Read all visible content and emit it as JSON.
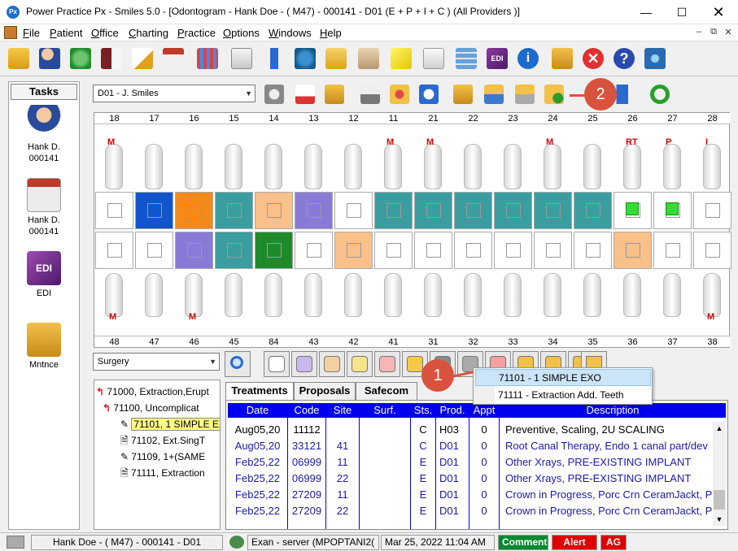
{
  "window": {
    "title": "Power Practice Px - Smiles 5.0 - [Odontogram - Hank Doe - ( M47) - 000141 - D01  (E + P + I + C )  (All Providers )]",
    "app_icon": "Px"
  },
  "menu": [
    "File",
    "Patient",
    "Office",
    "Charting",
    "Practice",
    "Options",
    "Windows",
    "Help"
  ],
  "tasks": {
    "header": "Tasks",
    "items": [
      {
        "label": "Hank D.\n000141",
        "icon": "patient-icon"
      },
      {
        "label": "Hank D.\n000141",
        "icon": "chart-icon"
      },
      {
        "label": "EDI",
        "icon": "edi-icon"
      },
      {
        "label": "Mntnce",
        "icon": "maintenance-icon"
      }
    ]
  },
  "provider_select": {
    "value": "D01 - J. Smiles"
  },
  "category_select": {
    "value": "Surgery"
  },
  "odontogram": {
    "upper_numbers": [
      "18",
      "17",
      "16",
      "15",
      "14",
      "13",
      "12",
      "11",
      "21",
      "22",
      "23",
      "24",
      "25",
      "26",
      "27",
      "28"
    ],
    "lower_numbers": [
      "48",
      "47",
      "46",
      "45",
      "84",
      "43",
      "42",
      "41",
      "31",
      "32",
      "33",
      "34",
      "35",
      "36",
      "37",
      "38"
    ],
    "upper_marks": [
      {
        "tooth": "18",
        "text": "M"
      },
      {
        "tooth": "11",
        "text": "M"
      },
      {
        "tooth": "21",
        "text": "M"
      },
      {
        "tooth": "24",
        "text": "M"
      },
      {
        "tooth": "26",
        "text": "RT"
      },
      {
        "tooth": "27",
        "text": "P"
      },
      {
        "tooth": "28",
        "text": "I"
      }
    ],
    "lower_marks": [
      {
        "tooth": "48",
        "text": "M"
      },
      {
        "tooth": "46",
        "text": "M"
      },
      {
        "tooth": "38",
        "text": "M"
      }
    ]
  },
  "procedure_tree": [
    {
      "label": "71000, Extraction,Erupt",
      "level": 0,
      "icon": "plus-red"
    },
    {
      "label": "71100, Uncomplicat",
      "level": 1,
      "icon": "plus-red"
    },
    {
      "label": "71101, 1 SIMPLE EXO",
      "level": 2,
      "icon": "pen-doc",
      "highlight": true
    },
    {
      "label": "71102, Ext.SingT",
      "level": 2,
      "icon": "doc"
    },
    {
      "label": "71109, 1+(SAME",
      "level": 2,
      "icon": "pen-doc"
    },
    {
      "label": "71111, Extraction",
      "level": 2,
      "icon": "doc"
    }
  ],
  "tabs": [
    "Treatments",
    "Proposals",
    "Safecom"
  ],
  "table": {
    "columns": [
      "Date",
      "Code",
      "Site",
      "Surf.",
      "Sts.",
      "Prod.",
      "Appt",
      "Description"
    ],
    "rows": [
      {
        "date": "Aug05,20",
        "code": "11112",
        "site": "",
        "surf": "",
        "sts": "C",
        "prod": "H03",
        "appt": "0",
        "desc": "Preventive, Scaling, 2U SCALING",
        "color": "#000000"
      },
      {
        "date": "Aug05,20",
        "code": "33121",
        "site": "41",
        "surf": "",
        "sts": "C",
        "prod": "D01",
        "appt": "0",
        "desc": "Root Canal Therapy, Endo 1 canal part/dev",
        "color": "#1a1aa6"
      },
      {
        "date": "Feb25,22",
        "code": "06999",
        "site": "11",
        "surf": "",
        "sts": "E",
        "prod": "D01",
        "appt": "0",
        "desc": "Other Xrays, PRE-EXISTING IMPLANT",
        "color": "#1a1aa6"
      },
      {
        "date": "Feb25,22",
        "code": "06999",
        "site": "22",
        "surf": "",
        "sts": "E",
        "prod": "D01",
        "appt": "0",
        "desc": "Other Xrays, PRE-EXISTING IMPLANT",
        "color": "#1a1aa6"
      },
      {
        "date": "Feb25,22",
        "code": "27209",
        "site": "11",
        "surf": "",
        "sts": "E",
        "prod": "D01",
        "appt": "0",
        "desc": "Crown in Progress, Porc Crn CeramJackt, Pl",
        "color": "#1a1aa6"
      },
      {
        "date": "Feb25,22",
        "code": "27209",
        "site": "22",
        "surf": "",
        "sts": "E",
        "prod": "D01",
        "appt": "0",
        "desc": "Crown in Progress, Porc Crn CeramJackt, Pl",
        "color": "#1a1aa6"
      }
    ]
  },
  "popup_menu": [
    "71101 - 1 SIMPLE EXO",
    "71111 - Extraction Add. Teeth"
  ],
  "callouts": [
    "1",
    "2"
  ],
  "status": {
    "patient": "Hank Doe - ( M47) - 000141 - D01",
    "server": "Exan - server (MPOPTANI2(",
    "datetime": "Mar 25, 2022 11:04 AM",
    "comment": "Comment",
    "alert": "Alert",
    "ag": "AG"
  },
  "colors": {
    "header_blue": "#0000ee",
    "comment_green": "#008a2e",
    "alert_red": "#e00000",
    "callout": "#d9523e",
    "teal": "#3a9ea0",
    "blue_fill": "#1155cc",
    "orange_fill": "#f48a1a",
    "peach_fill": "#f9c08a",
    "purple_fill": "#8a7ad8",
    "green_fill": "#1f8a2a",
    "lime_fill": "#33dd33"
  }
}
